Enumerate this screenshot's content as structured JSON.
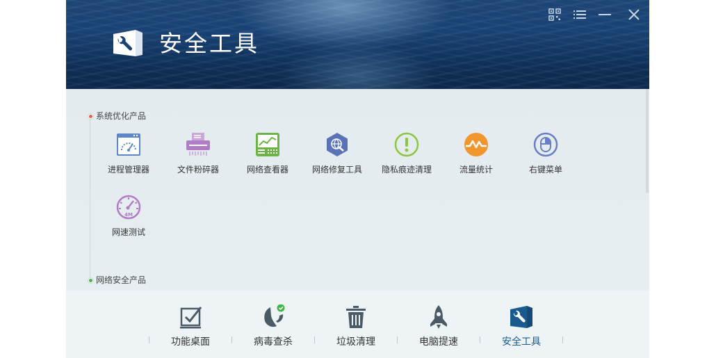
{
  "header": {
    "title": "安全工具",
    "controls": [
      "qrcode-icon",
      "menu-list-icon",
      "minimize-icon",
      "close-icon"
    ]
  },
  "sections": [
    {
      "title": "系统优化产品",
      "dot_color": "#e8604c"
    },
    {
      "title": "网络安全产品",
      "dot_color": "#44b34a"
    }
  ],
  "tools": [
    {
      "label": "进程管理器",
      "icon": "process-manager-icon",
      "color": "#5d86c6"
    },
    {
      "label": "文件粉碎器",
      "icon": "file-shredder-icon",
      "color": "#b07cc6"
    },
    {
      "label": "网络查看器",
      "icon": "network-viewer-icon",
      "color": "#6cb446"
    },
    {
      "label": "网络修复工具",
      "icon": "network-repair-icon",
      "color": "#5a73b8"
    },
    {
      "label": "隐私痕迹清理",
      "icon": "privacy-clean-icon",
      "color": "#8cc63f"
    },
    {
      "label": "流量统计",
      "icon": "traffic-stats-icon",
      "color": "#f0962c"
    },
    {
      "label": "右键菜单",
      "icon": "right-click-menu-icon",
      "color": "#6a7fc3"
    },
    {
      "label": "网速测试",
      "icon": "speed-test-icon",
      "color": "#b07cc6",
      "badge": "4M"
    }
  ],
  "nav": [
    {
      "label": "功能桌面",
      "icon": "checkbox-desktop-icon"
    },
    {
      "label": "病毒查杀",
      "icon": "virus-scan-icon"
    },
    {
      "label": "垃圾清理",
      "icon": "trash-icon"
    },
    {
      "label": "电脑提速",
      "icon": "rocket-icon"
    },
    {
      "label": "安全工具",
      "icon": "tools-icon",
      "active": true
    }
  ],
  "colors": {
    "accent": "#1b5a8f",
    "header_bg": "#184274"
  }
}
